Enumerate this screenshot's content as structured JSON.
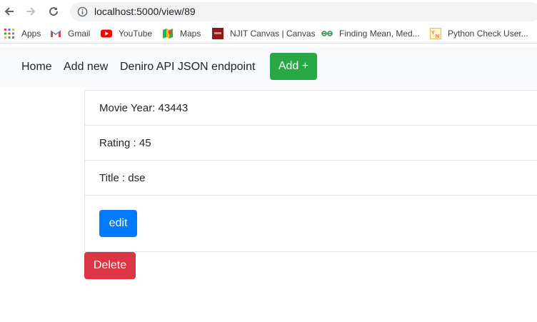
{
  "browser": {
    "url": "localhost:5000/view/89",
    "bookmarks": [
      {
        "label": "Apps",
        "icon": "apps-grid-icon"
      },
      {
        "label": "Gmail",
        "icon": "gmail-icon"
      },
      {
        "label": "YouTube",
        "icon": "youtube-icon"
      },
      {
        "label": "Maps",
        "icon": "maps-icon"
      },
      {
        "label": "NJIT Canvas | Canvas",
        "icon": "njit-icon"
      },
      {
        "label": "Finding Mean, Med...",
        "icon": "geeks-icon"
      },
      {
        "label": "Python Check User...",
        "icon": "yn-icon"
      }
    ]
  },
  "navbar": {
    "links": [
      "Home",
      "Add new",
      "Deniro API JSON endpoint"
    ],
    "add_button": "Add +"
  },
  "record": {
    "rows": [
      "Movie Year: 43443",
      "Rating : 45",
      "Title : dse"
    ],
    "edit_button": "edit",
    "delete_button": "Delete"
  },
  "colors": {
    "success": "#28a745",
    "primary": "#007bff",
    "danger": "#dc3545",
    "navbar_bg": "#f8f9fa"
  }
}
